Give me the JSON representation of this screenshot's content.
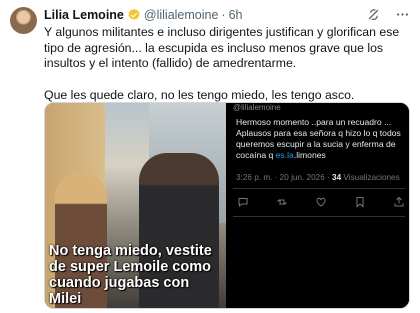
{
  "author": {
    "name": "Lilia Lemoine",
    "handle": "@lilialemoine",
    "separator": "·",
    "time": "6h"
  },
  "tweet": {
    "paragraph1": "Y algunos militantes e incluso dirigentes justifican y glorifican ese tipo de agresión... la escupida es incluso menos grave que los insultos y el intento (fallido) de amedrentarme.",
    "paragraph2": "Que les quede claro, no les tengo miedo, les tengo asco."
  },
  "media": {
    "video_caption": "No tenga miedo,  vestite de super Lemoile como cuando jugabas con Milei",
    "quoted": {
      "header_partial": "@lilialemoine",
      "text_before_link": "Hermoso momento ..para un recuadro ... Aplausos para esa señora q hizo lo q todos queremos escupir a la sucia y enferma de cocaína q ",
      "link_text": "es.la",
      "text_after_link": ".limones",
      "timestamp": "3:26 p. m. · 20 jun. 2026 · ",
      "views_count": "34",
      "views_label": " Visualizaciones"
    }
  },
  "icons": [
    "verified-badge-icon",
    "grok-icon",
    "more-icon",
    "reply-icon",
    "retweet-icon",
    "like-icon",
    "bookmark-icon",
    "share-icon"
  ],
  "colors": {
    "link": "#1d9bf0",
    "muted": "#536471",
    "verified": "#f4c430"
  }
}
